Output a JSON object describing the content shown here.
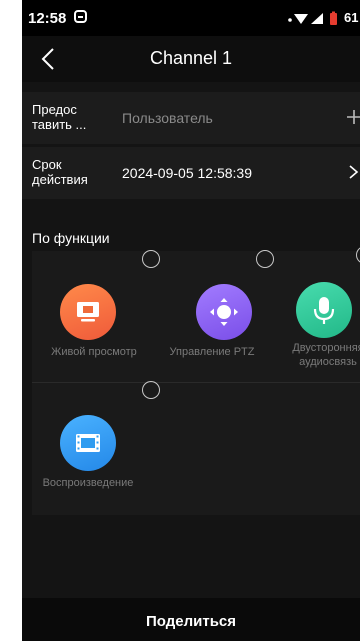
{
  "status_bar": {
    "time": "12:58",
    "battery": "61"
  },
  "header": {
    "title": "Channel 1"
  },
  "rows": {
    "share_to": {
      "label_line1": "Предос",
      "label_line2": "тавить ...",
      "placeholder": "Пользователь"
    },
    "validity": {
      "label_line1": "Срок",
      "label_line2": "действия",
      "value": "2024-09-05 12:58:39"
    }
  },
  "functions": {
    "title": "По функции",
    "items": [
      {
        "label": "Живой просмотр",
        "icon": "live-view-icon",
        "color": "#f26b3a"
      },
      {
        "label": "Управление PTZ",
        "icon": "ptz-icon",
        "color": "#8a5cf0"
      },
      {
        "label_line1": "Двусторонняя",
        "label_line2": "аудиосвязь",
        "icon": "microphone-icon",
        "color": "#2fc79a"
      },
      {
        "label": "Воспроизведение",
        "icon": "playback-icon",
        "color": "#2f9cf0"
      }
    ]
  },
  "share_button": {
    "label": "Поделиться"
  }
}
